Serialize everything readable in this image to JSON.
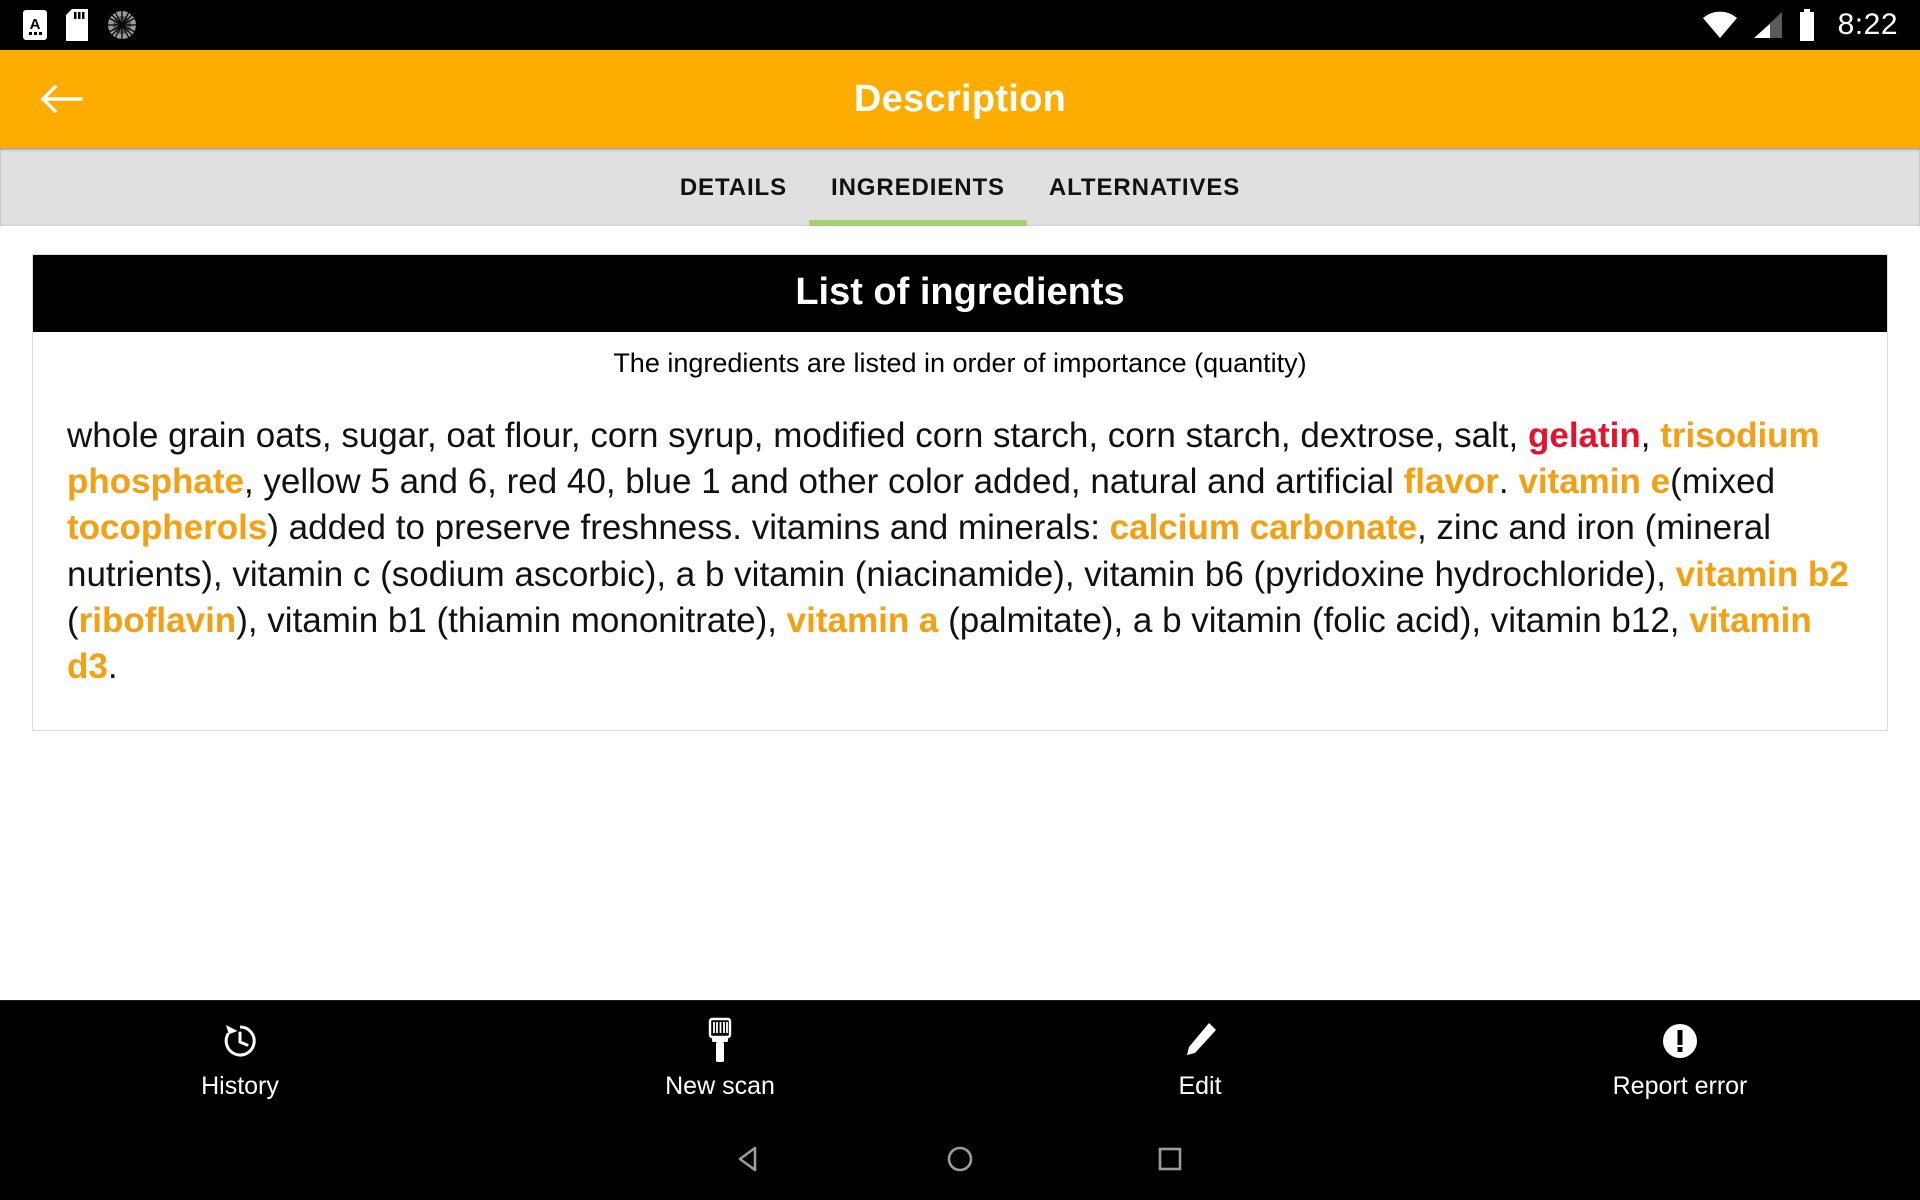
{
  "status_bar": {
    "icons": [
      "a-badge-icon",
      "sd-card-icon",
      "sunburst-icon"
    ],
    "right_icons": [
      "wifi-icon",
      "cellular-signal-icon",
      "battery-icon"
    ],
    "time": "8:22"
  },
  "app_bar": {
    "title": "Description",
    "back_icon": "arrow-left-icon",
    "background_color": "#FFAC00",
    "title_color": "#FFFFFF"
  },
  "tabs": {
    "items": [
      {
        "label": "DETAILS",
        "active": false
      },
      {
        "label": "INGREDIENTS",
        "active": true
      },
      {
        "label": "ALTERNATIVES",
        "active": false
      }
    ],
    "indicator_color": "#A5D075",
    "background_color": "#E0E0E0"
  },
  "card": {
    "header": "List of ingredients",
    "subtitle": "The ingredients are listed in order of importance (quantity)",
    "header_bg": "#000000",
    "header_text_color": "#FFFFFF",
    "highlight_orange": "#F5A013",
    "highlight_red": "#E8112D",
    "ingredients_segments": [
      {
        "text": "whole grain oats, sugar, oat flour, corn syrup, modified corn starch, corn starch, dextrose, salt, ",
        "style": "plain"
      },
      {
        "text": "gelatin",
        "style": "red"
      },
      {
        "text": ", ",
        "style": "plain"
      },
      {
        "text": "trisodium phosphate",
        "style": "orange"
      },
      {
        "text": ", yellow 5 and 6, red 40, blue 1 and other color added, natural and artificial ",
        "style": "plain"
      },
      {
        "text": "flavor",
        "style": "orange"
      },
      {
        "text": ". ",
        "style": "plain"
      },
      {
        "text": "vitamin e",
        "style": "orange"
      },
      {
        "text": "(mixed ",
        "style": "plain"
      },
      {
        "text": "tocopherols",
        "style": "orange"
      },
      {
        "text": ") added to preserve freshness. vitamins and minerals: ",
        "style": "plain"
      },
      {
        "text": "calcium carbonate",
        "style": "orange"
      },
      {
        "text": ", zinc and iron (mineral nutrients), vitamin c (sodium ascorbic), a b vitamin (niacinamide), vitamin b6 (pyridoxine hydrochloride), ",
        "style": "plain"
      },
      {
        "text": "vitamin b2",
        "style": "orange"
      },
      {
        "text": " (",
        "style": "plain"
      },
      {
        "text": "riboflavin",
        "style": "orange"
      },
      {
        "text": "), vitamin b1 (thiamin mononitrate), ",
        "style": "plain"
      },
      {
        "text": "vitamin a",
        "style": "orange"
      },
      {
        "text": " (palmitate), a b vitamin (folic acid), vitamin b12, ",
        "style": "plain"
      },
      {
        "text": "vitamin d3",
        "style": "orange"
      },
      {
        "text": ".",
        "style": "plain"
      }
    ]
  },
  "bottom_nav": {
    "items": [
      {
        "label": "History",
        "icon": "history-clock-icon"
      },
      {
        "label": "New scan",
        "icon": "barcode-scanner-icon"
      },
      {
        "label": "Edit",
        "icon": "pencil-icon"
      },
      {
        "label": "Report error",
        "icon": "error-exclamation-icon"
      }
    ]
  },
  "android_nav": {
    "back": "triangle-back-icon",
    "home": "circle-home-icon",
    "recents": "square-recents-icon"
  }
}
